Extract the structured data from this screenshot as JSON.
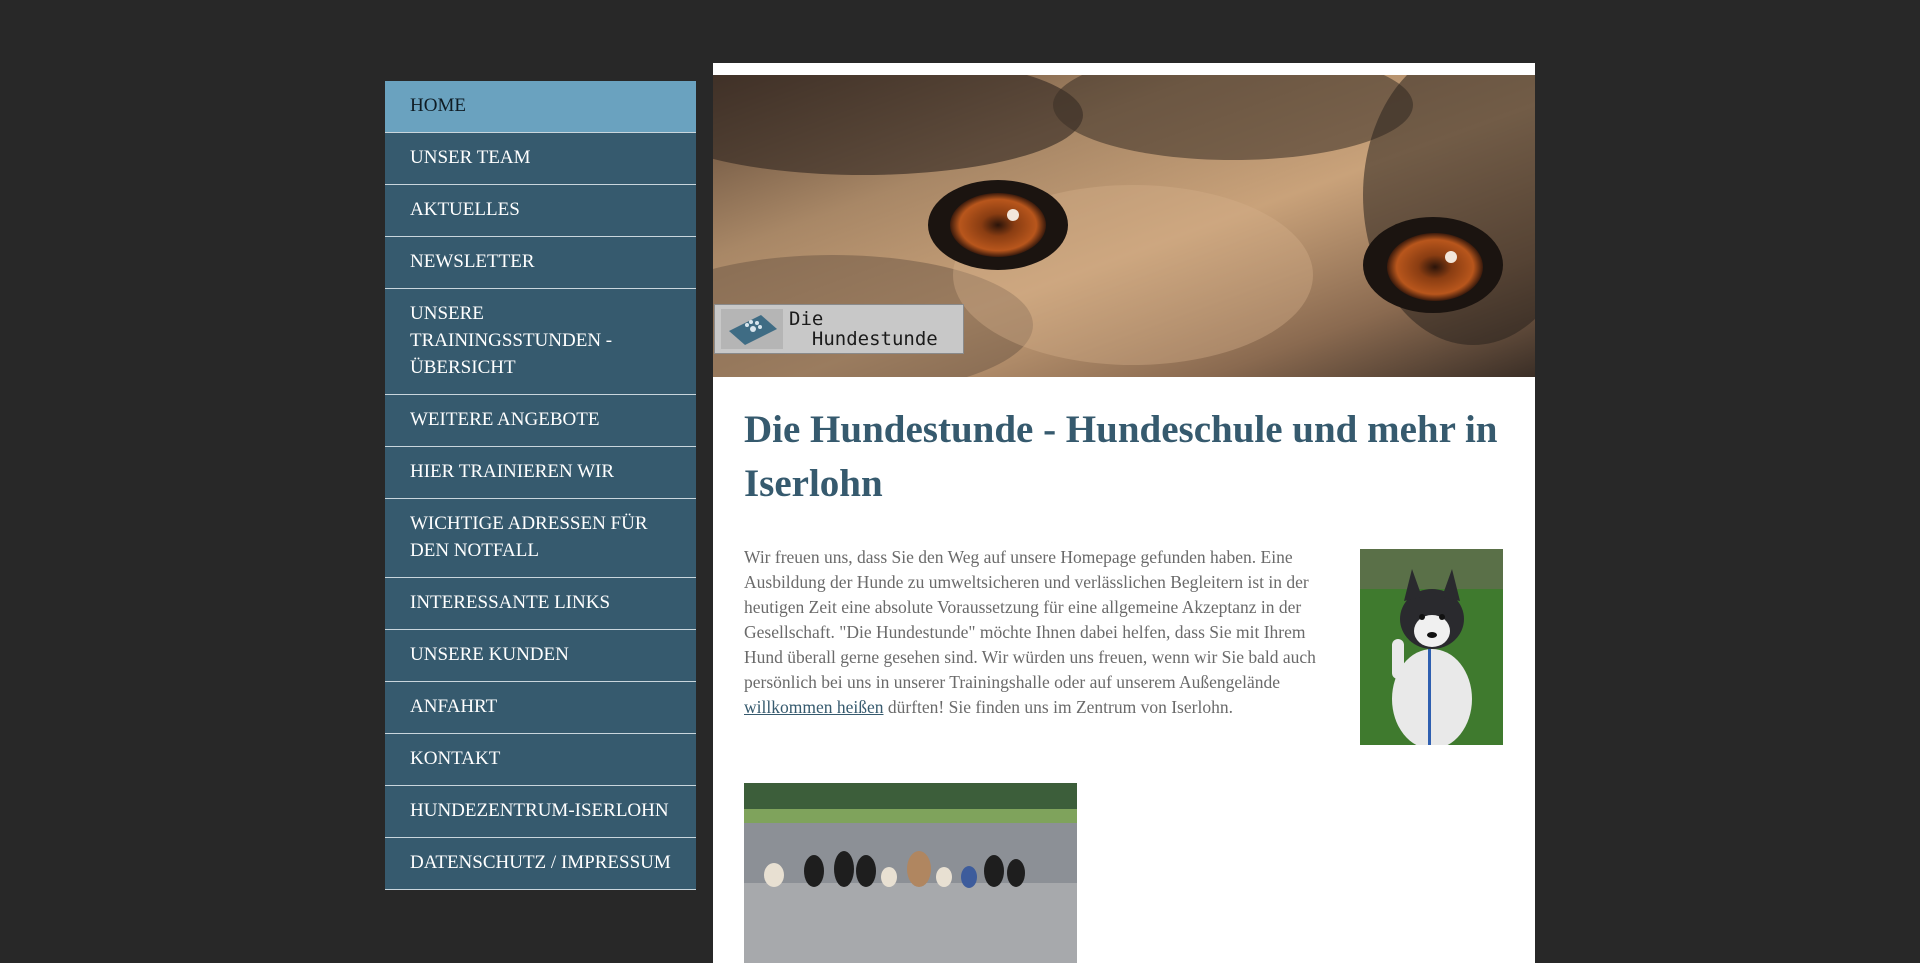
{
  "nav": {
    "items": [
      {
        "label": "HOME",
        "active": true
      },
      {
        "label": "UNSER TEAM"
      },
      {
        "label": "AKTUELLES"
      },
      {
        "label": "NEWSLETTER"
      },
      {
        "label": "UNSERE TRAININGSSTUNDEN - ÜBERSICHT"
      },
      {
        "label": "WEITERE ANGEBOTE"
      },
      {
        "label": "HIER TRAINIEREN WIR"
      },
      {
        "label": "WICHTIGE ADRESSEN FÜR DEN NOTFALL"
      },
      {
        "label": "INTERESSANTE LINKS"
      },
      {
        "label": "UNSERE KUNDEN"
      },
      {
        "label": "ANFAHRT"
      },
      {
        "label": "KONTAKT"
      },
      {
        "label": "HUNDEZENTRUM-ISERLOHN"
      },
      {
        "label": "DATENSCHUTZ / IMPRESSUM"
      }
    ]
  },
  "header": {
    "logo_line1": "Die",
    "logo_line2": "  Hundestunde"
  },
  "main": {
    "title": "Die Hundestunde - Hundeschule und mehr in Iserlohn",
    "intro_before_link": "Wir freuen uns, dass Sie den Weg auf unsere Homepage gefunden haben. Eine Ausbildung der Hunde zu umweltsicheren und verlässlichen Begleitern ist in der heutigen Zeit eine absolute Voraussetzung für eine allgemeine Akzeptanz in der Gesellschaft. \"Die Hundestunde\" möchte Ihnen dabei helfen, dass Sie mit Ihrem Hund überall gerne gesehen sind. Wir würden uns freuen, wenn wir Sie bald auch persönlich bei uns in unserer Trainingshalle oder auf unserem Außengelände ",
    "intro_link": "willkommen heißen",
    "intro_after_link": " dürften! Sie finden uns im Zentrum von Iserlohn."
  },
  "colors": {
    "background": "#282828",
    "nav_bg": "#365a6e",
    "nav_active_bg": "#6aa2bf",
    "title": "#365a6e",
    "body_text": "#6a6a6a"
  }
}
